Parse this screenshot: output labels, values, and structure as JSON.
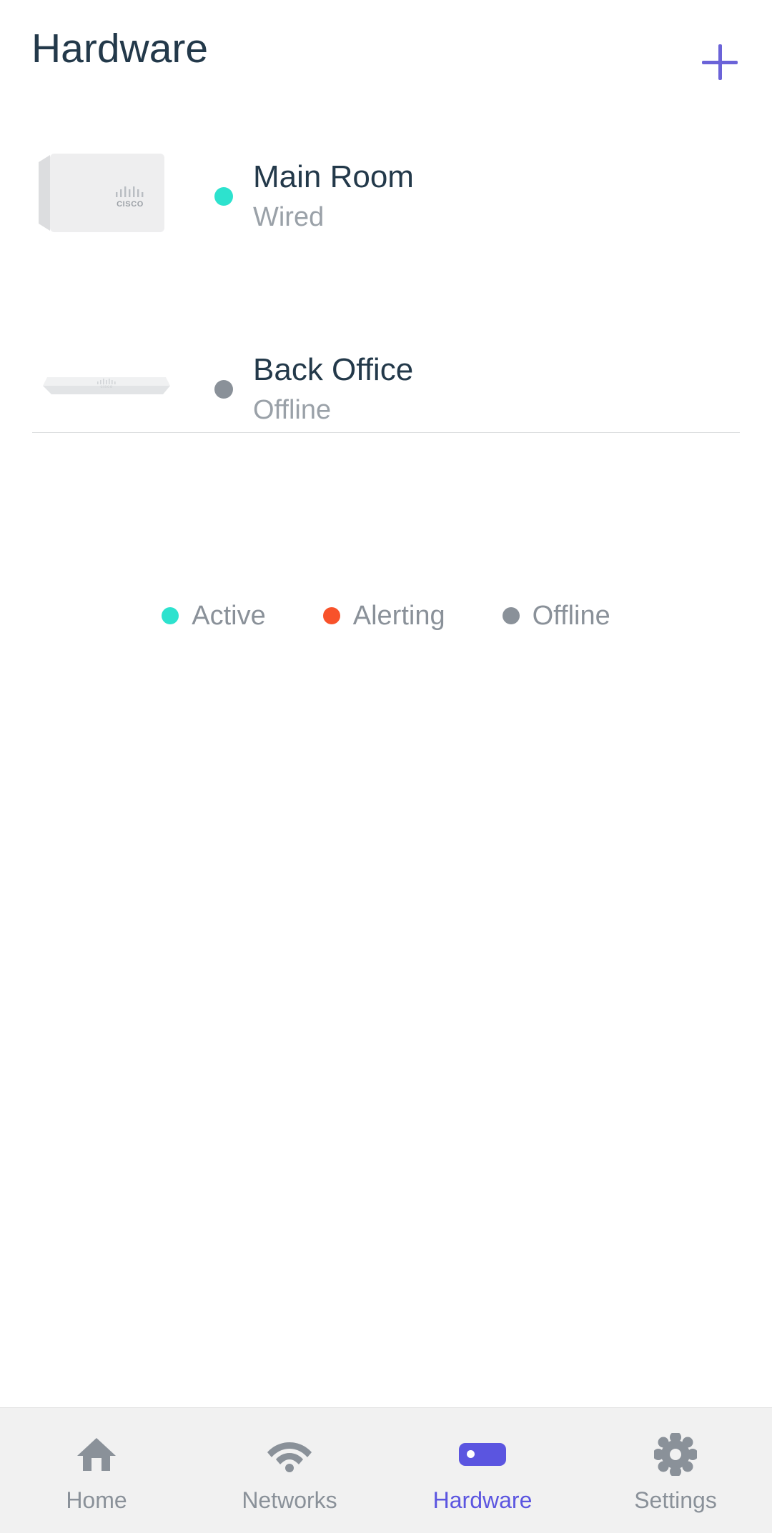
{
  "header": {
    "title": "Hardware",
    "add_icon": "plus-icon",
    "accent_color": "#6B63D8"
  },
  "devices": [
    {
      "name": "Main Room",
      "status": "Wired",
      "status_color": "#2DE2CE",
      "thumb_icon": "access-point-image",
      "brand": "CISCO"
    },
    {
      "name": "Back Office",
      "status": "Offline",
      "status_color": "#8A9199",
      "thumb_icon": "switch-image",
      "brand": "cisco"
    }
  ],
  "legend": [
    {
      "label": "Active",
      "color": "#2DE2CE"
    },
    {
      "label": "Alerting",
      "color": "#F8522A"
    },
    {
      "label": "Offline",
      "color": "#8A9199"
    }
  ],
  "bottom_nav": {
    "active": "Hardware",
    "items": [
      {
        "label": "Home",
        "icon": "home-icon"
      },
      {
        "label": "Networks",
        "icon": "wifi-icon"
      },
      {
        "label": "Hardware",
        "icon": "hardware-device-icon"
      },
      {
        "label": "Settings",
        "icon": "gear-icon"
      }
    ]
  }
}
